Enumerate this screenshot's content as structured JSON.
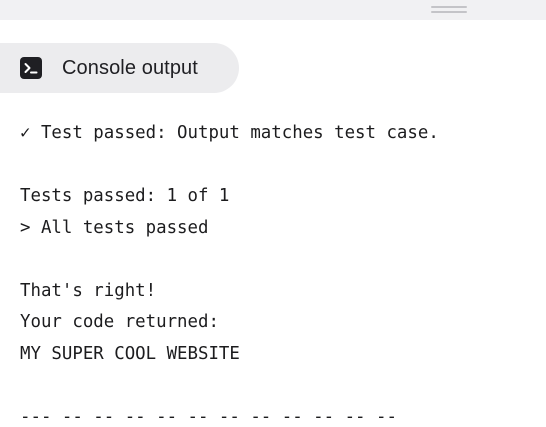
{
  "console": {
    "tab_label": "Console output",
    "tab_icon": "terminal-icon",
    "lines": {
      "result": "✓ Test passed: Output matches test case.",
      "tests_count": "Tests passed: 1 of 1",
      "all_passed": "> All tests passed",
      "feedback": "That's right!",
      "returned_label": "Your code returned:",
      "returned_value": "MY SUPER COOL WEBSITE",
      "separator": "--- -- -- -- -- -- -- -- -- -- -- --"
    }
  },
  "colors": {
    "top_strip": "#f1f1f3",
    "tab_background": "#ececee",
    "text": "#1c1c1e",
    "icon_background": "#1f1f23"
  }
}
